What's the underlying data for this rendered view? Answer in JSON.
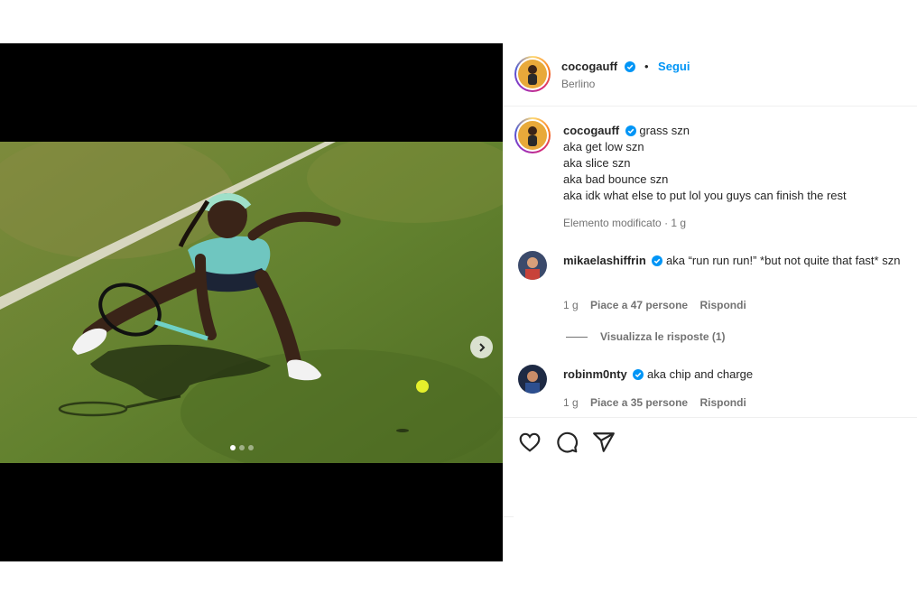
{
  "post": {
    "author": "cocogauff",
    "follow_label": "Segui",
    "separator": "•",
    "location": "Berlino"
  },
  "caption": {
    "author": "cocogauff",
    "lines": [
      "grass szn",
      "aka get low szn",
      "aka slice szn",
      "aka bad bounce szn",
      "aka idk what else to put lol you guys can finish the rest"
    ],
    "edited_label": "Elemento modificato",
    "dot": "·",
    "time": "1 g"
  },
  "comments": [
    {
      "author": "mikaelashiffrin",
      "text": "aka “run run run!” *but not quite that fast* szn",
      "time": "1 g",
      "likes": "Piace a 47 persone",
      "reply": "Rispondi"
    },
    {
      "author": "robinm0nty",
      "text": "aka chip and charge",
      "time": "1 g",
      "likes": "Piace a 35 persone",
      "reply": "Rispondi"
    }
  ],
  "view_replies": "Visualizza le risposte (1)",
  "icons": {
    "like": "heart-icon",
    "comment": "comment-icon",
    "share": "share-icon",
    "verified": "verified-badge-icon",
    "next": "chevron-right-icon"
  },
  "colors": {
    "accent": "#0095f6",
    "grass": "#5f7a2c",
    "secondary_text": "#737373"
  },
  "carousel": {
    "slides": 3,
    "active": 1
  }
}
